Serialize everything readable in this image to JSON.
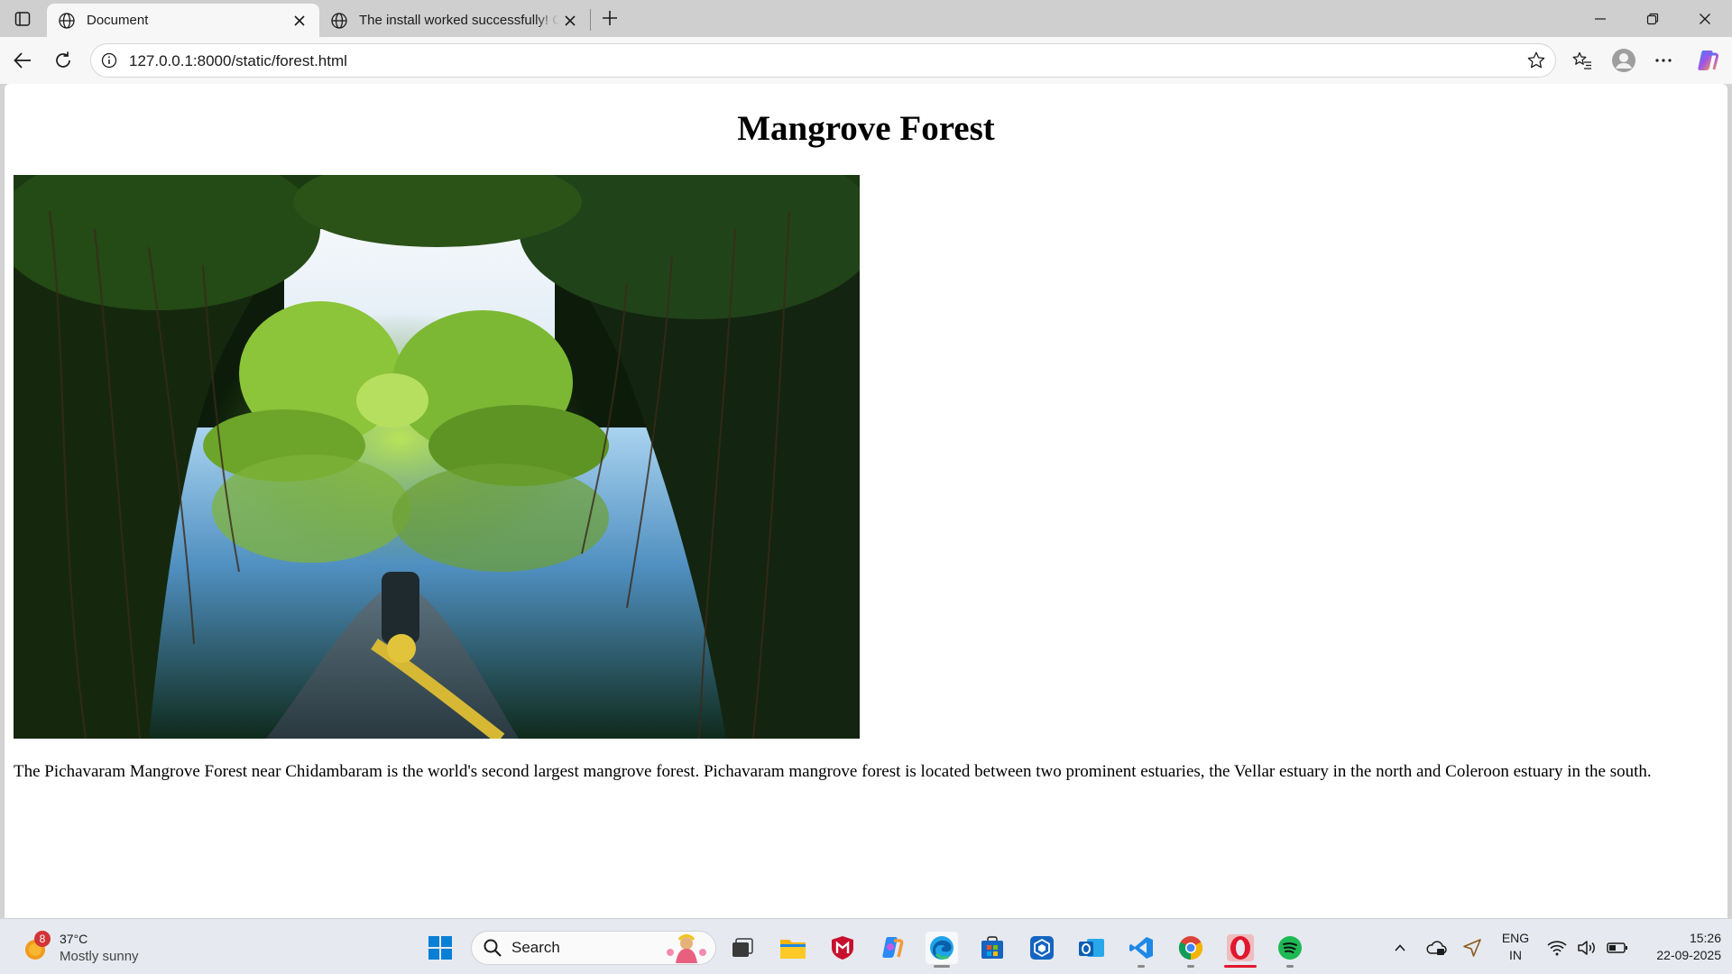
{
  "browser": {
    "tabs": [
      {
        "title": "Document",
        "active": true,
        "icon": "globe-icon"
      },
      {
        "title": "The install worked successfully! Congratulations!",
        "active": false,
        "icon": "globe-icon"
      }
    ],
    "address": "127.0.0.1:8000/static/forest.html"
  },
  "page": {
    "heading": "Mangrove Forest",
    "paragraph": "The Pichavaram Mangrove Forest near Chidambaram is the world's second largest mangrove forest. Pichavaram mangrove forest is located between two prominent estuaries, the Vellar estuary in the north and Coleroon estuary in the south."
  },
  "taskbar": {
    "weather": {
      "badge": "8",
      "temperature": "37°C",
      "condition": "Mostly sunny"
    },
    "search_label": "Search",
    "apps": [
      "task-view-icon",
      "file-explorer-icon",
      "mcafee-icon",
      "copilot-icon",
      "edge-icon",
      "store-icon",
      "dev-home-icon",
      "outlook-icon",
      "vscode-icon",
      "chrome-icon",
      "opera-icon",
      "spotify-icon"
    ],
    "tray": {
      "language": "ENG",
      "region": "IN",
      "time": "15:26",
      "date": "22-09-2025"
    }
  },
  "colors": {
    "accent_edge": "#0078d4",
    "taskbar": "#e6e9ef",
    "page_bg": "#ffffff"
  }
}
